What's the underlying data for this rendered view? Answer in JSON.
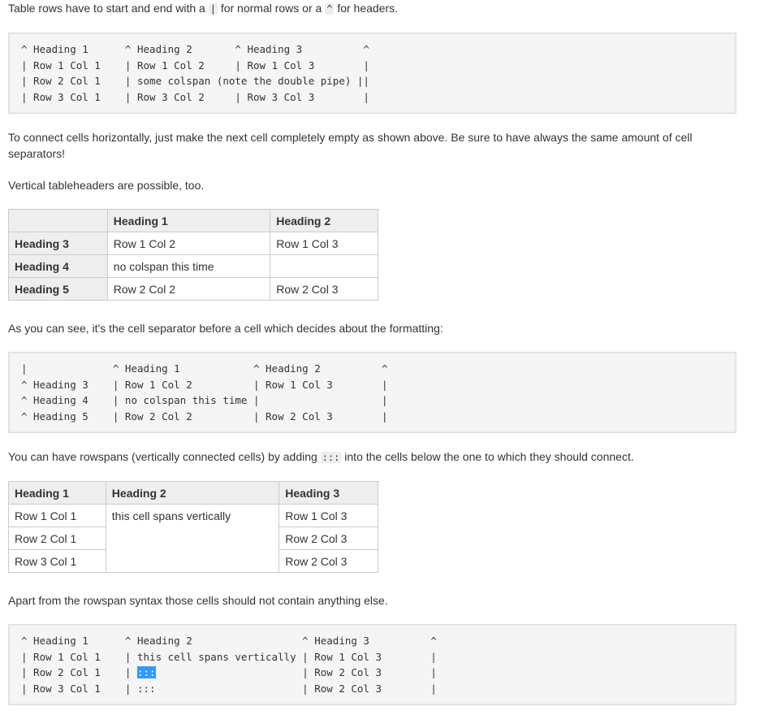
{
  "p1": {
    "before": "Table rows have to start and end with a ",
    "code1": "|",
    "middle": " for normal rows or a ",
    "code2": "^",
    "after": " for headers."
  },
  "code1": {
    "lines": [
      "^ Heading 1      ^ Heading 2       ^ Heading 3          ^",
      "| Row 1 Col 1    | Row 1 Col 2     | Row 1 Col 3        |",
      "| Row 2 Col 1    | some colspan (note the double pipe) ||",
      "| Row 3 Col 1    | Row 3 Col 2     | Row 3 Col 3        |"
    ]
  },
  "p2": "To connect cells horizontally, just make the next cell completely empty as shown above. Be sure to have always the same amount of cell separators!",
  "p3": "Vertical tableheaders are possible, too.",
  "table1": {
    "header": [
      "",
      "Heading 1",
      "Heading 2"
    ],
    "rows": [
      [
        "Heading 3",
        "Row 1 Col 2",
        "Row 1 Col 3"
      ],
      [
        "Heading 4",
        "no colspan this time",
        ""
      ],
      [
        "Heading 5",
        "Row 2 Col 2",
        "Row 2 Col 3"
      ]
    ]
  },
  "p4": "As you can see, it's the cell separator before a cell which decides about the formatting:",
  "code2": {
    "lines": [
      "|              ^ Heading 1            ^ Heading 2          ^",
      "^ Heading 3    | Row 1 Col 2          | Row 1 Col 3        |",
      "^ Heading 4    | no colspan this time |                    |",
      "^ Heading 5    | Row 2 Col 2          | Row 2 Col 3        |"
    ]
  },
  "p5": {
    "before": "You can have rowspans (vertically connected cells) by adding ",
    "code": ":::",
    "after": " into the cells below the one to which they should connect."
  },
  "table2": {
    "header": [
      "Heading 1",
      "Heading 2",
      "Heading 3"
    ],
    "rows": [
      [
        "Row 1 Col 1",
        "this cell spans vertically",
        "Row 1 Col 3"
      ],
      [
        "Row 2 Col 1",
        "Row 2 Col 3"
      ],
      [
        "Row 3 Col 1",
        "Row 2 Col 3"
      ]
    ]
  },
  "p6": "Apart from the rowspan syntax those cells should not contain anything else.",
  "code3": {
    "lines": [
      "^ Heading 1      ^ Heading 2                  ^ Heading 3          ^",
      "| Row 1 Col 1    | this cell spans vertically | Row 1 Col 3        |",
      "| Row 2 Col 1    | ",
      "| Row 3 Col 1    | :::                        | Row 2 Col 3        |"
    ],
    "line3_selected": ":::",
    "line3_rest": "                        | Row 2 Col 3        |"
  }
}
